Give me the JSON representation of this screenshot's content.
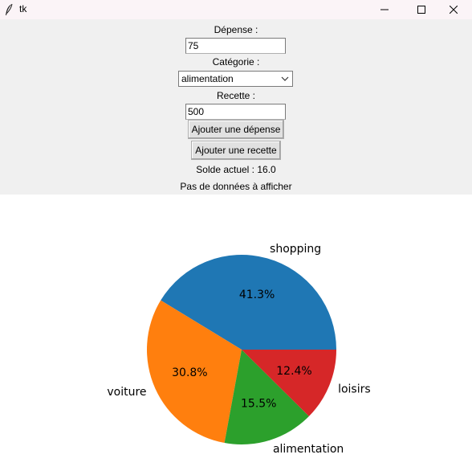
{
  "window": {
    "title": "tk",
    "icons": [
      "feather-icon",
      "minimize-icon",
      "maximize-icon",
      "close-icon"
    ]
  },
  "form": {
    "expense_label": "Dépense :",
    "expense_value": "75",
    "category_label": "Catégorie :",
    "category_selected": "alimentation",
    "income_label": "Recette :",
    "income_value": "500",
    "add_expense_button": "Ajouter une dépense",
    "add_income_button": "Ajouter une recette",
    "balance_text": "Solde actuel : 16.0",
    "no_data_text": "Pas de données à afficher"
  },
  "chart_data": {
    "type": "pie",
    "categories": [
      "shopping",
      "voiture",
      "alimentation",
      "loisirs"
    ],
    "values": [
      41.3,
      30.8,
      15.5,
      12.4
    ],
    "value_labels": [
      "41.3%",
      "30.8%",
      "15.5%",
      "12.4%"
    ],
    "colors": [
      "#1f77b4",
      "#ff7f0e",
      "#2ca02c",
      "#d62728"
    ],
    "start_angle_deg": 0,
    "direction": "counterclockwise"
  }
}
